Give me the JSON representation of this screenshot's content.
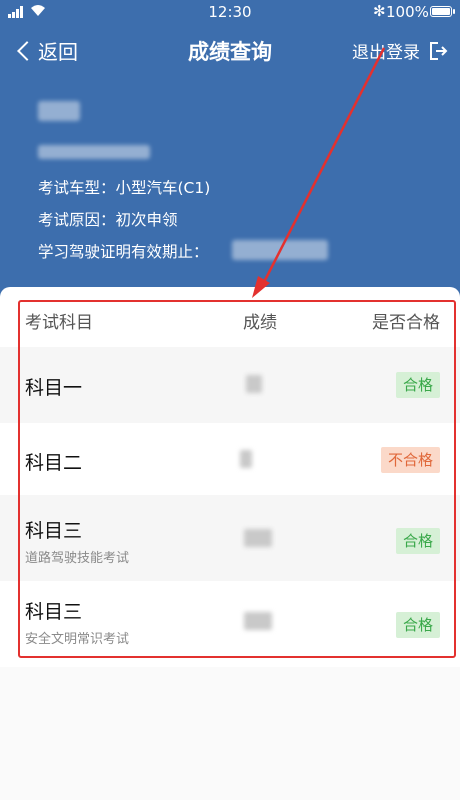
{
  "status_bar": {
    "time": "12:30",
    "battery": "100%",
    "bluetooth_symbol": "✻"
  },
  "nav": {
    "back_label": "返回",
    "title": "成绩查询",
    "logout_label": "退出登录"
  },
  "profile": {
    "car_type": "考试车型：小型汽车(C1)",
    "exam_reason": "考试原因：初次申领",
    "license_valid_label": "学习驾驶证明有效期止："
  },
  "table": {
    "headers": {
      "subject": "考试科目",
      "score": "成绩",
      "passed": "是否合格"
    },
    "rows": [
      {
        "subject": "科目一",
        "detail": "",
        "result": "合格",
        "status": "pass"
      },
      {
        "subject": "科目二",
        "detail": "",
        "result": "不合格",
        "status": "fail"
      },
      {
        "subject": "科目三",
        "detail": "道路驾驶技能考试",
        "result": "合格",
        "status": "pass"
      },
      {
        "subject": "科目三",
        "detail": "安全文明常识考试",
        "result": "合格",
        "status": "pass"
      }
    ]
  },
  "colors": {
    "header_bg": "#3d6ead",
    "pass_bg": "#d6f0d6",
    "pass_text": "#3aa84a",
    "fail_bg": "#fbd9c9",
    "fail_text": "#e0683a",
    "annotation": "#e3312f"
  }
}
